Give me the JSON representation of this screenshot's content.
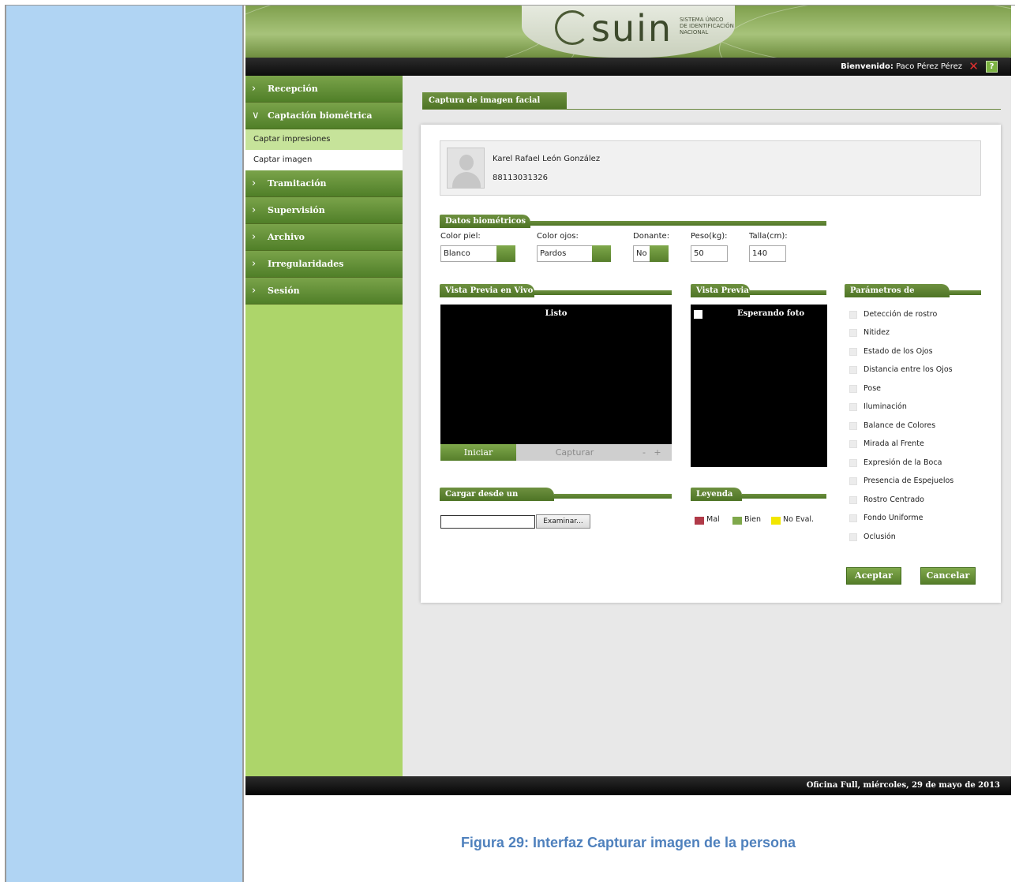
{
  "app": {
    "logo_text": "suin",
    "logo_subtitle": [
      "SISTEMA ÚNICO",
      "DE IDENTIFICACIÓN",
      "NACIONAL"
    ],
    "welcome_label": "Bienvenido:",
    "user_name": "Paco Pérez Pérez",
    "help_symbol": "?",
    "close_symbol": "✕"
  },
  "sidebar": {
    "items": [
      {
        "label": "Recepción",
        "expanded": false
      },
      {
        "label": "Captación biométrica",
        "expanded": true
      },
      {
        "label": "Tramitación",
        "expanded": false
      },
      {
        "label": "Supervisión",
        "expanded": false
      },
      {
        "label": "Archivo",
        "expanded": false
      },
      {
        "label": "Irregularidades",
        "expanded": false
      },
      {
        "label": "Sesión",
        "expanded": false
      }
    ],
    "subitems": [
      {
        "label": "Captar impresiones",
        "active": true
      },
      {
        "label": "Captar imagen",
        "active": false
      }
    ],
    "chevron_collapsed": "›",
    "chevron_expanded": "∨"
  },
  "page": {
    "title": "Captura de imagen facial"
  },
  "person": {
    "name": "Karel Rafael León González",
    "id_number": "88113031326"
  },
  "biometrics": {
    "section_title": "Datos biométricos",
    "skin_color_label": "Color piel:",
    "skin_color_value": "Blanco",
    "eye_color_label": "Color ojos:",
    "eye_color_value": "Pardos",
    "donor_label": "Donante:",
    "donor_value": "No",
    "weight_label": "Peso(kg):",
    "weight_value": "50",
    "height_label": "Talla(cm):",
    "height_value": "140"
  },
  "live_preview": {
    "section_title": "Vista Previa en Vivo",
    "status": "Listo",
    "start_label": "Iniciar",
    "capture_label": "Capturar",
    "zoom_out": "-",
    "zoom_in": "+"
  },
  "preview": {
    "section_title": "Vista Previa",
    "status": "Esperando foto"
  },
  "quality": {
    "section_title": "Parámetros de Calidad",
    "items": [
      "Detección de rostro",
      "Nitidez",
      "Estado de los Ojos",
      "Distancia entre los Ojos",
      "Pose",
      "Iluminación",
      "Balance de Colores",
      "Mirada al Frente",
      "Expresión de la Boca",
      "Presencia de Espejuelos",
      "Rostro Centrado",
      "Fondo Uniforme",
      "Oclusión"
    ]
  },
  "file_load": {
    "section_title": "Cargar desde un Fichero",
    "browse_label": "Examinar..."
  },
  "legend": {
    "section_title": "Leyenda",
    "items": [
      {
        "label": "Mal",
        "color": "#b03a48"
      },
      {
        "label": "Bien",
        "color": "#7fa84b"
      },
      {
        "label": "No Eval.",
        "color": "#f2e600"
      }
    ]
  },
  "actions": {
    "accept_label": "Aceptar",
    "cancel_label": "Cancelar"
  },
  "footer": {
    "text": "Oficina Full, miércoles, 29 de mayo de 2013"
  },
  "document": {
    "caption": "Figura 29: Interfaz Capturar imagen de la persona"
  },
  "colors": {
    "accent_green": "#567e2b",
    "sidebar_green": "#add56a",
    "caption_blue": "#4f81bd",
    "doc_margin_blue": "#b0d4f3"
  }
}
